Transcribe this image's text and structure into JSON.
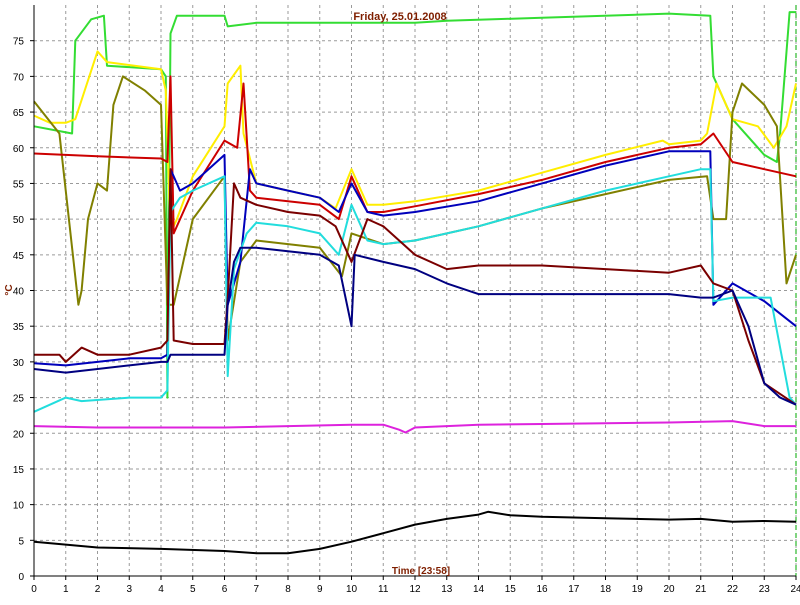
{
  "chart_data": {
    "type": "line",
    "title": "Friday, 25.01.2008",
    "xlabel": "Time [23:58]",
    "ylabel": "°C",
    "xlim": [
      0,
      24
    ],
    "ylim": [
      0,
      80
    ],
    "grid": true,
    "x_ticks": [
      "0",
      "1",
      "2",
      "3",
      "4",
      "5",
      "6",
      "7",
      "8",
      "9",
      "10",
      "11",
      "12",
      "13",
      "14",
      "15",
      "16",
      "17",
      "18",
      "19",
      "20",
      "21",
      "22",
      "23",
      "24"
    ],
    "y_ticks": [
      "0",
      "5",
      "10",
      "15",
      "20",
      "25",
      "30",
      "35",
      "40",
      "45",
      "50",
      "55",
      "60",
      "65",
      "70",
      "75"
    ],
    "series": [
      {
        "color": "#33dd33",
        "points": [
          [
            0,
            63
          ],
          [
            1.2,
            62
          ],
          [
            1.3,
            75
          ],
          [
            1.8,
            78
          ],
          [
            2.2,
            78.5
          ],
          [
            2.3,
            71.5
          ],
          [
            4,
            71
          ],
          [
            4.15,
            70
          ],
          [
            4.2,
            25
          ],
          [
            4.3,
            76
          ],
          [
            4.5,
            78.5
          ],
          [
            5,
            78.5
          ],
          [
            6,
            78.5
          ],
          [
            6.1,
            77
          ],
          [
            7,
            77.5
          ],
          [
            12,
            77.5
          ],
          [
            13,
            77.8
          ],
          [
            16,
            78.2
          ],
          [
            20,
            78.8
          ],
          [
            21.3,
            78.5
          ],
          [
            21.4,
            70
          ],
          [
            22,
            64
          ],
          [
            23,
            59
          ],
          [
            23.4,
            58
          ],
          [
            23.5,
            62
          ],
          [
            23.8,
            79
          ],
          [
            24,
            79
          ]
        ]
      },
      {
        "color": "#ffee00",
        "points": [
          [
            0,
            64.5
          ],
          [
            0.5,
            63.5
          ],
          [
            1,
            63.5
          ],
          [
            1.3,
            64
          ],
          [
            2,
            73.5
          ],
          [
            2.3,
            72
          ],
          [
            4,
            71
          ],
          [
            4.15,
            68
          ],
          [
            4.3,
            48
          ],
          [
            4.5,
            50
          ],
          [
            5,
            56
          ],
          [
            6,
            63
          ],
          [
            6.1,
            69
          ],
          [
            6.5,
            71.5
          ],
          [
            6.6,
            62
          ],
          [
            7,
            55
          ],
          [
            8,
            54
          ],
          [
            9,
            53
          ],
          [
            9.5,
            51.5
          ],
          [
            10,
            57
          ],
          [
            10.5,
            52
          ],
          [
            11,
            52
          ],
          [
            12,
            52.5
          ],
          [
            14,
            54
          ],
          [
            16,
            56.5
          ],
          [
            18,
            59
          ],
          [
            19.8,
            61
          ],
          [
            20,
            60.5
          ],
          [
            21,
            61
          ],
          [
            21.2,
            62
          ],
          [
            21.5,
            69
          ],
          [
            22,
            64
          ],
          [
            22.8,
            63
          ],
          [
            23.3,
            60
          ],
          [
            23.7,
            63
          ],
          [
            24,
            69
          ]
        ]
      },
      {
        "color": "#808000",
        "points": [
          [
            0,
            66.5
          ],
          [
            0.8,
            62
          ],
          [
            1.1,
            50
          ],
          [
            1.4,
            38
          ],
          [
            1.5,
            40
          ],
          [
            1.7,
            50
          ],
          [
            2,
            55
          ],
          [
            2.3,
            54
          ],
          [
            2.5,
            66
          ],
          [
            2.8,
            70
          ],
          [
            3.5,
            68
          ],
          [
            4,
            66
          ],
          [
            4.2,
            38
          ],
          [
            4.4,
            38
          ],
          [
            5,
            50
          ],
          [
            6,
            56
          ],
          [
            6.1,
            33
          ],
          [
            6.5,
            44
          ],
          [
            7,
            47
          ],
          [
            8,
            46.5
          ],
          [
            9,
            46
          ],
          [
            9.7,
            42
          ],
          [
            10,
            48
          ],
          [
            11,
            46.5
          ],
          [
            12,
            47
          ],
          [
            14,
            49
          ],
          [
            16,
            51.5
          ],
          [
            18,
            53.5
          ],
          [
            20,
            55.5
          ],
          [
            21.2,
            56
          ],
          [
            21.4,
            50
          ],
          [
            21.8,
            50
          ],
          [
            22,
            65
          ],
          [
            22.3,
            69
          ],
          [
            23,
            66
          ],
          [
            23.4,
            63
          ],
          [
            23.7,
            41
          ],
          [
            24,
            45
          ]
        ]
      },
      {
        "color": "#cc0000",
        "points": [
          [
            0,
            59.2
          ],
          [
            2,
            58.8
          ],
          [
            4,
            58.5
          ],
          [
            4.2,
            58
          ],
          [
            4.3,
            70
          ],
          [
            4.4,
            48
          ],
          [
            5,
            54
          ],
          [
            6,
            61
          ],
          [
            6.4,
            60
          ],
          [
            6.6,
            69
          ],
          [
            6.8,
            54
          ],
          [
            7,
            53
          ],
          [
            8,
            52.5
          ],
          [
            9,
            52
          ],
          [
            9.6,
            50
          ],
          [
            10,
            56
          ],
          [
            10.5,
            51
          ],
          [
            11,
            51
          ],
          [
            12,
            51.8
          ],
          [
            14,
            53.5
          ],
          [
            16,
            55.5
          ],
          [
            18,
            58
          ],
          [
            20,
            60
          ],
          [
            21,
            60.5
          ],
          [
            21.4,
            62
          ],
          [
            22,
            58
          ],
          [
            23,
            57
          ],
          [
            24,
            56
          ]
        ]
      },
      {
        "color": "#0000bb",
        "points": [
          [
            0,
            29.8
          ],
          [
            1,
            29.5
          ],
          [
            2,
            30
          ],
          [
            3,
            30.5
          ],
          [
            4,
            30.5
          ],
          [
            4.2,
            31
          ],
          [
            4.3,
            57
          ],
          [
            4.6,
            54
          ],
          [
            5,
            55
          ],
          [
            6,
            59
          ],
          [
            6.1,
            38
          ],
          [
            6.5,
            44
          ],
          [
            6.8,
            57
          ],
          [
            7,
            55
          ],
          [
            8,
            54
          ],
          [
            9,
            53
          ],
          [
            9.6,
            51
          ],
          [
            10,
            55
          ],
          [
            10.5,
            51
          ],
          [
            11,
            50.5
          ],
          [
            12,
            51
          ],
          [
            14,
            52.5
          ],
          [
            16,
            55
          ],
          [
            18,
            57.5
          ],
          [
            20,
            59.5
          ],
          [
            21,
            59.5
          ],
          [
            21.3,
            59.5
          ],
          [
            21.4,
            38
          ],
          [
            22,
            41
          ],
          [
            23,
            38.5
          ],
          [
            24,
            35
          ]
        ]
      },
      {
        "color": "#22dddd",
        "points": [
          [
            0,
            23
          ],
          [
            1,
            25
          ],
          [
            1.5,
            24.5
          ],
          [
            3,
            25
          ],
          [
            4,
            25
          ],
          [
            4.2,
            26
          ],
          [
            4.3,
            51
          ],
          [
            4.6,
            53
          ],
          [
            5,
            54
          ],
          [
            6,
            56
          ],
          [
            6.1,
            28
          ],
          [
            6.3,
            43
          ],
          [
            6.7,
            48
          ],
          [
            7,
            49.5
          ],
          [
            8,
            49
          ],
          [
            9,
            48
          ],
          [
            9.6,
            45
          ],
          [
            10,
            52
          ],
          [
            10.5,
            47
          ],
          [
            11,
            46.5
          ],
          [
            12,
            47
          ],
          [
            14,
            49
          ],
          [
            16,
            51.5
          ],
          [
            18,
            54
          ],
          [
            20,
            56
          ],
          [
            21,
            57
          ],
          [
            21.3,
            57
          ],
          [
            21.4,
            38.5
          ],
          [
            22,
            39
          ],
          [
            23.2,
            39
          ],
          [
            23.5,
            32
          ],
          [
            23.8,
            25
          ],
          [
            24,
            24
          ]
        ]
      },
      {
        "color": "#7a0000",
        "points": [
          [
            0,
            31
          ],
          [
            0.8,
            31
          ],
          [
            1,
            30
          ],
          [
            1.5,
            32
          ],
          [
            2,
            31
          ],
          [
            3,
            31
          ],
          [
            4,
            32
          ],
          [
            4.2,
            33
          ],
          [
            4.3,
            57
          ],
          [
            4.4,
            33
          ],
          [
            5,
            32.5
          ],
          [
            6,
            32.5
          ],
          [
            6.1,
            39
          ],
          [
            6.3,
            55
          ],
          [
            6.5,
            53
          ],
          [
            7,
            52
          ],
          [
            8,
            51
          ],
          [
            9,
            50.5
          ],
          [
            9.5,
            49
          ],
          [
            10,
            44
          ],
          [
            10.5,
            50
          ],
          [
            11,
            49
          ],
          [
            12,
            45
          ],
          [
            13,
            43
          ],
          [
            14,
            43.5
          ],
          [
            16,
            43.5
          ],
          [
            18,
            43
          ],
          [
            20,
            42.5
          ],
          [
            21,
            43.5
          ],
          [
            21.4,
            41
          ],
          [
            22,
            40
          ],
          [
            22.5,
            33
          ],
          [
            23,
            27
          ],
          [
            24,
            24
          ]
        ]
      },
      {
        "color": "#000080",
        "points": [
          [
            0,
            29
          ],
          [
            1,
            28.5
          ],
          [
            2,
            29
          ],
          [
            3,
            29.5
          ],
          [
            4,
            30
          ],
          [
            4.2,
            30
          ],
          [
            4.3,
            31
          ],
          [
            5,
            31
          ],
          [
            6,
            31
          ],
          [
            6.1,
            38
          ],
          [
            6.3,
            44
          ],
          [
            6.5,
            46
          ],
          [
            7,
            46
          ],
          [
            8,
            45.5
          ],
          [
            9,
            45
          ],
          [
            9.6,
            43.5
          ],
          [
            10,
            35
          ],
          [
            10.1,
            45
          ],
          [
            11,
            44
          ],
          [
            12,
            43
          ],
          [
            13,
            41
          ],
          [
            14,
            39.5
          ],
          [
            16,
            39.5
          ],
          [
            18,
            39.5
          ],
          [
            20,
            39.5
          ],
          [
            21,
            39
          ],
          [
            21.4,
            39
          ],
          [
            22,
            40
          ],
          [
            22.5,
            35
          ],
          [
            23,
            27
          ],
          [
            23.5,
            25
          ],
          [
            24,
            24
          ]
        ]
      },
      {
        "color": "#dd22dd",
        "points": [
          [
            0,
            21
          ],
          [
            2,
            20.8
          ],
          [
            4,
            20.8
          ],
          [
            6,
            20.8
          ],
          [
            8,
            21
          ],
          [
            10,
            21.2
          ],
          [
            11,
            21.2
          ],
          [
            11.5,
            20.5
          ],
          [
            11.7,
            20.1
          ],
          [
            12,
            20.8
          ],
          [
            14,
            21.2
          ],
          [
            16,
            21.3
          ],
          [
            18,
            21.4
          ],
          [
            20,
            21.5
          ],
          [
            22,
            21.7
          ],
          [
            23,
            21
          ],
          [
            24,
            21
          ]
        ]
      },
      {
        "color": "#000000",
        "points": [
          [
            0,
            4.8
          ],
          [
            1,
            4.4
          ],
          [
            2,
            4
          ],
          [
            4,
            3.8
          ],
          [
            6,
            3.5
          ],
          [
            7,
            3.2
          ],
          [
            8,
            3.2
          ],
          [
            9,
            3.8
          ],
          [
            10,
            4.8
          ],
          [
            11,
            6
          ],
          [
            12,
            7.2
          ],
          [
            13,
            8
          ],
          [
            14,
            8.6
          ],
          [
            14.3,
            9
          ],
          [
            15,
            8.5
          ],
          [
            16,
            8.3
          ],
          [
            18,
            8.1
          ],
          [
            20,
            7.9
          ],
          [
            21,
            8
          ],
          [
            22,
            7.6
          ],
          [
            23,
            7.7
          ],
          [
            24,
            7.6
          ]
        ]
      }
    ]
  }
}
